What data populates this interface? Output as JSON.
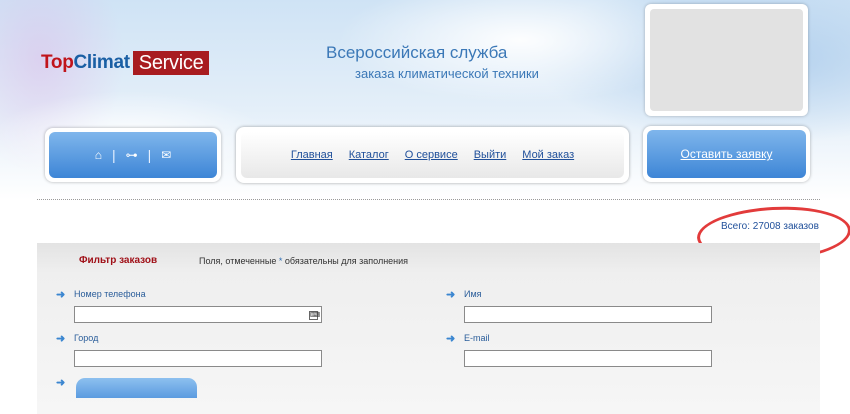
{
  "colors": {
    "brand_red": "#c0141b",
    "brand_blue": "#1a5fa4",
    "link": "#1f4f9a",
    "button_blue": "#3d85d6",
    "annotation": "#e23b3b"
  },
  "logo": {
    "top": "Top",
    "climat": "Climat",
    "service": "Service"
  },
  "slogan": {
    "line1": "Всероссийская служба",
    "line2": "заказа климатической техники"
  },
  "iconnav": {
    "home_icon": "⌂",
    "sitemap_icon": "⊶",
    "mail_icon": "✉",
    "separator": "|"
  },
  "menu": {
    "items": [
      "Главная",
      "Каталог",
      "О сервисе",
      "Выйти",
      "Мой заказ"
    ]
  },
  "order_button": {
    "label": "Оставить заявку"
  },
  "stats": {
    "total": "Всего: 27008 заказов"
  },
  "filter": {
    "title": "Фильтр заказов",
    "note_before": "Поля, отмеченные",
    "note_star": "*",
    "note_after": "обязательны для заполнения",
    "arrow": "➜",
    "phone": {
      "label": "Номер телефона",
      "value": ""
    },
    "name": {
      "label": "Имя",
      "value": ""
    },
    "city": {
      "label": "Город",
      "value": ""
    },
    "email": {
      "label": "E-mail",
      "value": ""
    },
    "keyboard_icon": "⌨"
  }
}
